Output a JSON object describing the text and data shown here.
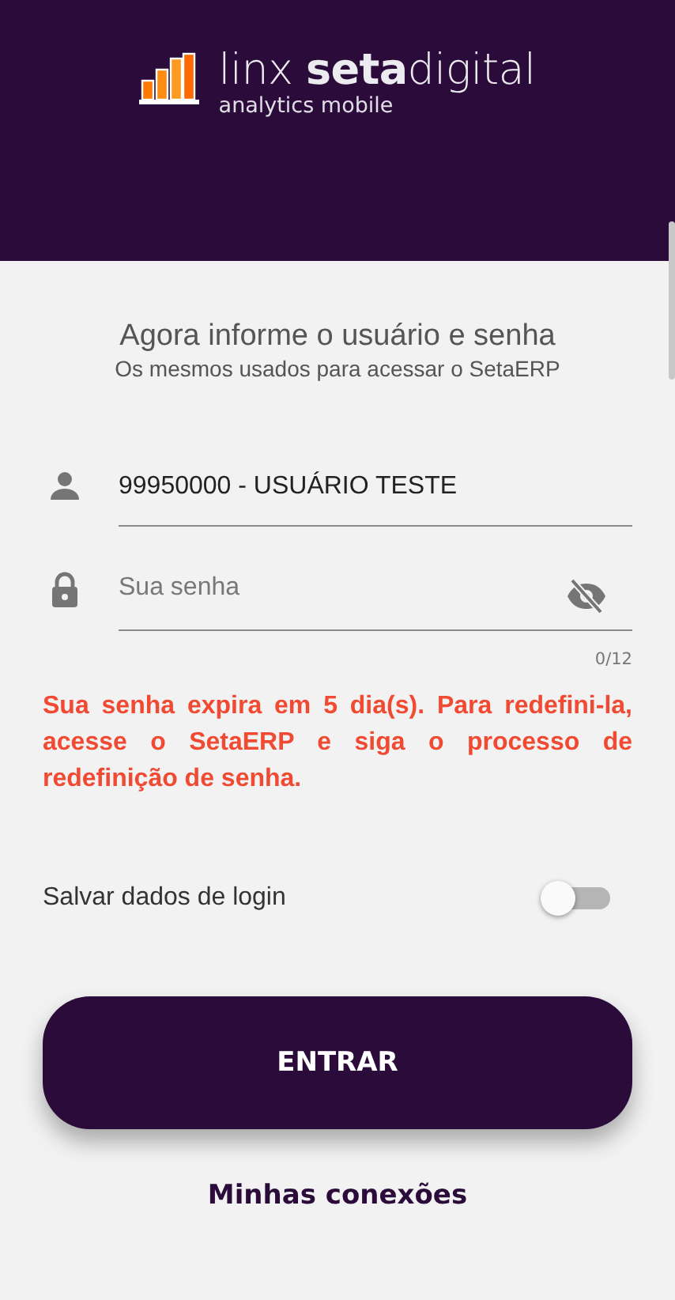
{
  "logo": {
    "brand": "linx **seta**digital",
    "subtitle": "analytics mobile"
  },
  "heading": {
    "title": "Agora informe o usuário e senha",
    "subtitle": "Os mesmos usados para acessar o SetaERP"
  },
  "user_field": {
    "value": "99950000 - USUÁRIO TESTE"
  },
  "password_field": {
    "placeholder": "Sua senha",
    "counter": "0/12"
  },
  "warning": "Sua senha expira em 5 dia(s). Para redefini-la, acesse o SetaERP e siga o processo de redefinição de senha.",
  "save_login": {
    "label": "Salvar dados de login",
    "on": false
  },
  "buttons": [
    {
      "kind": "primary",
      "label": "ENTRAR"
    },
    {
      "kind": "link",
      "label": "Minhas conexões"
    }
  ]
}
